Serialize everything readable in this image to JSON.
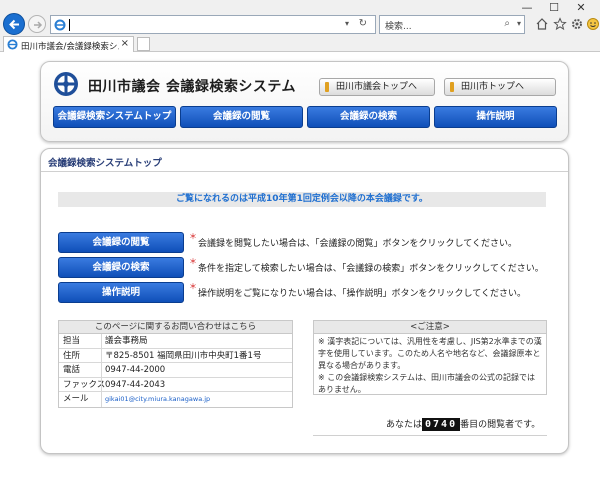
{
  "browser": {
    "address_value": "",
    "search_placeholder": "検索...",
    "tab_title": "田川市議会/会議録検索シス...",
    "colors": {
      "back_button": "#1b6fd0",
      "chrome": "#f0f0f0"
    }
  },
  "header": {
    "site_title": "田川市議会 会議録検索システム",
    "link_council_top": "田川市議会トップへ",
    "link_city_top": "田川市トップへ",
    "menu": [
      {
        "label": "会議録検索システムトップ"
      },
      {
        "label": "会議録の閲覧"
      },
      {
        "label": "会議録の検索"
      },
      {
        "label": "操作説明"
      }
    ]
  },
  "main": {
    "title": "会議録検索システムトップ",
    "notice": "ご覧になれるのは平成10年第1回定例会以降の本会議録です。",
    "actions": [
      {
        "button": "会議録の閲覧",
        "mark": "＊",
        "description": "会議録を閲覧したい場合は、「会議録の閲覧」ボタンをクリックしてください。"
      },
      {
        "button": "会議録の検索",
        "mark": "＊",
        "description": "条件を指定して検索したい場合は、「会議録の検索」ボタンをクリックしてください。"
      },
      {
        "button": "操作説明",
        "mark": "＊",
        "description": "操作説明をご覧になりたい場合は、「操作説明」ボタンをクリックしてください。"
      }
    ],
    "contact": {
      "heading": "このページに関するお問い合わせはこちら",
      "rows": [
        {
          "label": "担当",
          "value": "議会事務局"
        },
        {
          "label": "住所",
          "value": "〒825-8501 福岡県田川市中央町1番1号"
        },
        {
          "label": "電話",
          "value": "0947-44-2000"
        },
        {
          "label": "ファックス",
          "value": "0947-44-2043"
        },
        {
          "label": "メール",
          "value": "gikai01@city.miura.kanagawa.jp"
        }
      ]
    },
    "caution": {
      "heading": "<ご注意>",
      "body_1": "※ 漢字表記については、汎用性を考慮し、JIS第2水準までの漢字を使用しています。このため人名や地名など、会議録原本と異なる場合があります。",
      "body_2": "※ この会議録検索システムは、田川市議会の公式の記録ではありません。"
    },
    "counter": {
      "prefix": "あなたは",
      "number": "0740",
      "suffix": "番目の閲覧者です。"
    }
  }
}
